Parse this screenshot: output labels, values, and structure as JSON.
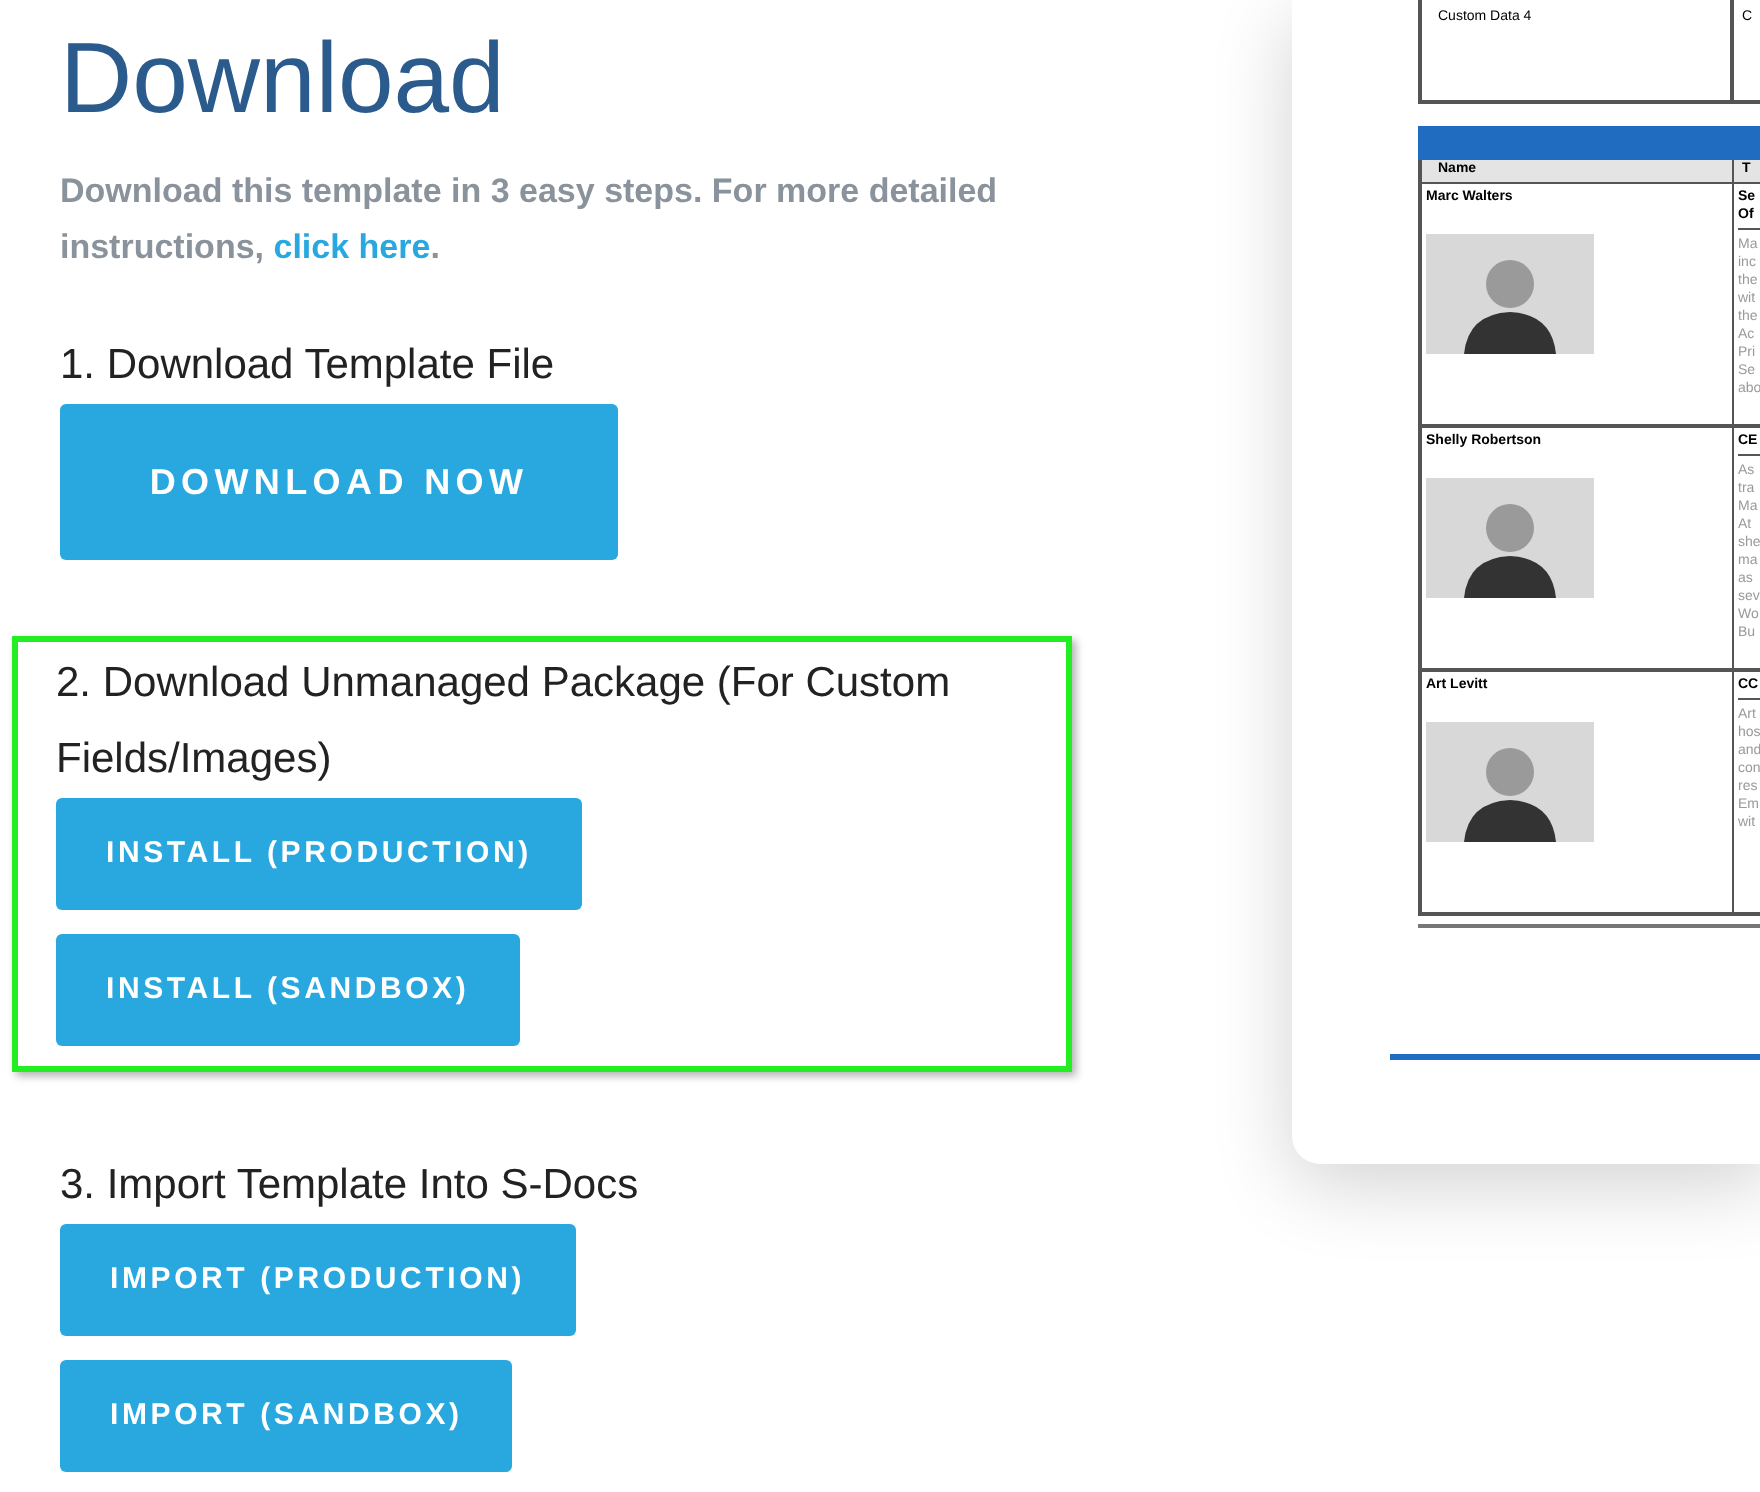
{
  "heading": "Download",
  "intro": {
    "text": "Download this template in 3 easy steps. For more detailed instructions, ",
    "link": "click here",
    "end": "."
  },
  "steps": [
    {
      "title": "1. Download Template File",
      "highlighted": false,
      "buttons": [
        {
          "label": "DOWNLOAD NOW",
          "kind": "large"
        }
      ]
    },
    {
      "title": "2. Download Unmanaged Package (For Custom Fields/Images)",
      "highlighted": true,
      "buttons": [
        {
          "label": "INSTALL (PRODUCTION)",
          "kind": "small"
        },
        {
          "label": "INSTALL (SANDBOX)",
          "kind": "small"
        }
      ]
    },
    {
      "title": "3. Import Template Into S-Docs",
      "highlighted": false,
      "buttons": [
        {
          "label": "IMPORT (PRODUCTION)",
          "kind": "small"
        },
        {
          "label": "IMPORT (SANDBOX)",
          "kind": "small"
        }
      ]
    }
  ],
  "preview": {
    "top_cells": [
      "Custom Data 4",
      "C"
    ],
    "table": {
      "columns": [
        "Name",
        "T"
      ],
      "rows": [
        {
          "name": "Marc Walters",
          "title": [
            "Se",
            "Of"
          ],
          "bio": [
            "Ma",
            "inc",
            "the",
            "wit",
            "the",
            "Ac",
            "Pri",
            "Se",
            "abo"
          ]
        },
        {
          "name": "Shelly Robertson",
          "title": [
            "CE"
          ],
          "bio": [
            "As",
            "tra",
            "Ma",
            "At",
            "she",
            "ma",
            "as",
            "sev",
            "Wo",
            "Bu"
          ]
        },
        {
          "name": "Art Levitt",
          "title": [
            "CC"
          ],
          "bio": [
            "Art",
            "hos",
            "and",
            "con",
            "res",
            "Em",
            "wit"
          ]
        }
      ]
    }
  }
}
